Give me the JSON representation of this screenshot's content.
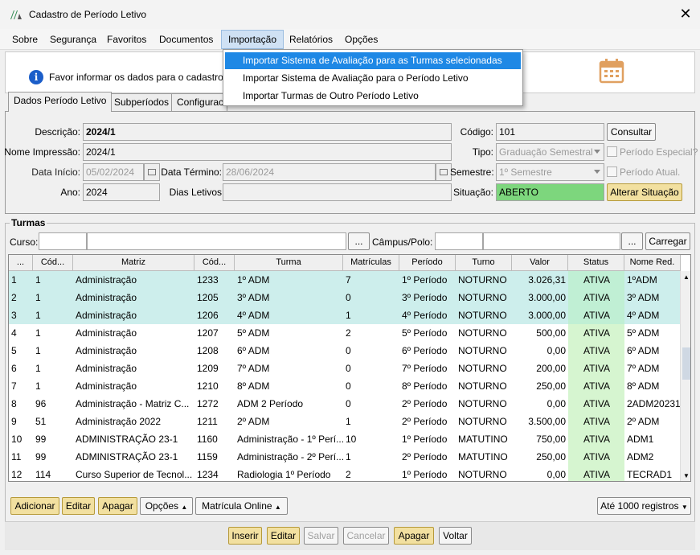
{
  "window": {
    "title": "Cadastro de Período Letivo"
  },
  "menu": [
    "Sobre",
    "Segurança",
    "Favoritos",
    "Documentos",
    "Importação",
    "Relatórios",
    "Opções"
  ],
  "dropdown": [
    "Importar Sistema de Avaliação para as Turmas selecionadas",
    "Importar Sistema de Avaliação para o Período Letivo",
    "Importar Turmas de Outro Período Letivo"
  ],
  "info": {
    "message": "Favor informar os dados para o cadastro."
  },
  "tabs": [
    "Dados Período Letivo",
    "Subperíodos",
    "Configurac"
  ],
  "form": {
    "descricao_label": "Descrição:",
    "descricao": "2024/1",
    "nome_impressao_label": "Nome Impressão:",
    "nome_impressao": "2024/1",
    "data_inicio_label": "Data Início:",
    "data_inicio": "05/02/2024",
    "data_termino_label": "Data Término:",
    "data_termino": "28/06/2024",
    "ano_label": "Ano:",
    "ano": "2024",
    "dias_letivos_label": "Dias Letivos",
    "codigo_label": "Código:",
    "codigo": "101",
    "consultar": "Consultar",
    "tipo_label": "Tipo:",
    "tipo": "Graduação Semestral",
    "periodo_especial": "Período Especial?",
    "semestre_label": "Semestre:",
    "semestre": "1º Semestre",
    "periodo_atual": "Período Atual.",
    "situacao_label": "Situação:",
    "situacao": "ABERTO",
    "alterar_situacao": "Alterar Situação"
  },
  "turmas": {
    "title": "Turmas",
    "curso_label": "Curso:",
    "campus_label": "Câmpus/Polo:",
    "ellipsis": "...",
    "carregar": "Carregar",
    "columns": [
      "...",
      "Cód...",
      "Matriz",
      "Cód...",
      "Turma",
      "Matrículas",
      "Período",
      "Turno",
      "Valor",
      "Status",
      "Nome Red."
    ],
    "rows": [
      [
        "1",
        "1",
        "Administração",
        "1233",
        "1º ADM",
        "7",
        "1º Período",
        "NOTURNO",
        "3.026,31",
        "ATIVA",
        "1ºADM"
      ],
      [
        "2",
        "1",
        "Administração",
        "1205",
        "3º ADM",
        "0",
        "3º Período",
        "NOTURNO",
        "3.000,00",
        "ATIVA",
        "3º ADM"
      ],
      [
        "3",
        "1",
        "Administração",
        "1206",
        "4º ADM",
        "1",
        "4º Período",
        "NOTURNO",
        "3.000,00",
        "ATIVA",
        "4º ADM"
      ],
      [
        "4",
        "1",
        "Administração",
        "1207",
        "5º ADM",
        "2",
        "5º Período",
        "NOTURNO",
        "500,00",
        "ATIVA",
        "5º ADM"
      ],
      [
        "5",
        "1",
        "Administração",
        "1208",
        "6º ADM",
        "0",
        "6º Período",
        "NOTURNO",
        "0,00",
        "ATIVA",
        "6º ADM"
      ],
      [
        "6",
        "1",
        "Administração",
        "1209",
        "7º ADM",
        "0",
        "7º Período",
        "NOTURNO",
        "200,00",
        "ATIVA",
        "7º ADM"
      ],
      [
        "7",
        "1",
        "Administração",
        "1210",
        "8º ADM",
        "0",
        "8º Período",
        "NOTURNO",
        "250,00",
        "ATIVA",
        "8º ADM"
      ],
      [
        "8",
        "96",
        "Administração - Matriz C...",
        "1272",
        "ADM 2 Período",
        "0",
        "2º Período",
        "NOTURNO",
        "0,00",
        "ATIVA",
        "2ADM20231"
      ],
      [
        "9",
        "51",
        "Administração 2022",
        "1211",
        "2º ADM",
        "1",
        "2º Período",
        "NOTURNO",
        "3.500,00",
        "ATIVA",
        "2º ADM"
      ],
      [
        "10",
        "99",
        "ADMINISTRAÇÃO 23-1",
        "1160",
        "Administração - 1º Perí...",
        "10",
        "1º Período",
        "MATUTINO",
        "750,00",
        "ATIVA",
        "ADM1"
      ],
      [
        "11",
        "99",
        "ADMINISTRAÇÃO 23-1",
        "1159",
        "Administração - 2º Perí...",
        "1",
        "2º Período",
        "MATUTINO",
        "250,00",
        "ATIVA",
        "ADM2"
      ],
      [
        "12",
        "114",
        "Curso Superior de Tecnol...",
        "1234",
        "Radiologia 1º Período",
        "2",
        "1º Período",
        "NOTURNO",
        "0,00",
        "ATIVA",
        "TECRAD1"
      ]
    ],
    "buttons": [
      "Adicionar",
      "Editar",
      "Apagar",
      "Opções",
      "Matrícula Online"
    ],
    "limit": "Até 1000 registros"
  },
  "footer": [
    "Inserir",
    "Editar",
    "Salvar",
    "Cancelar",
    "Apagar",
    "Voltar"
  ],
  "colors": {
    "highlight": "#1e88e5",
    "selected_row": "#cdeeec",
    "situacao": "#7dd67d",
    "status_cell": "#d6f5d0"
  }
}
